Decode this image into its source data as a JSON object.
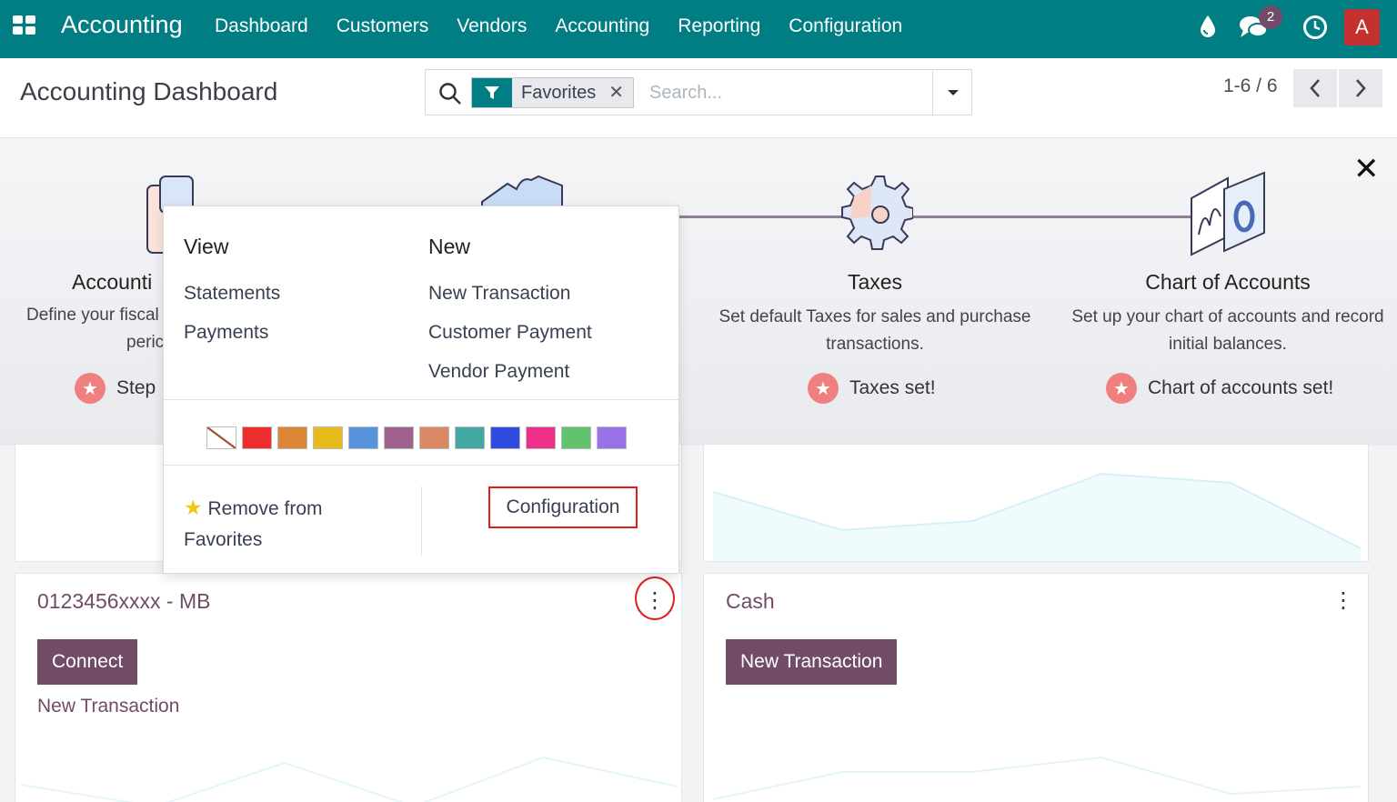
{
  "topnav": {
    "app_name": "Accounting",
    "menu": [
      "Dashboard",
      "Customers",
      "Vendors",
      "Accounting",
      "Reporting",
      "Configuration"
    ],
    "messages_count": "2",
    "avatar_letter": "A",
    "bar_color": "#017e84",
    "icons": [
      "apps-grid-icon",
      "drop-icon",
      "chat-icon",
      "clock-icon"
    ]
  },
  "control_panel": {
    "title": "Accounting Dashboard",
    "facet": "Favorites",
    "search_placeholder": "Search...",
    "pager": "1-6 / 6"
  },
  "onboarding": {
    "steps": [
      {
        "title": "Accounti",
        "desc_line1": "Define your fiscal",
        "desc_line2": "peric",
        "status": "Step"
      },
      {
        "title": "Taxes",
        "desc_line1": "Set default Taxes for sales and purchase",
        "desc_line2": "transactions.",
        "status": "Taxes set!"
      },
      {
        "title": "Chart of Accounts",
        "desc_line1": "Set up your chart of accounts and record",
        "desc_line2": "initial balances.",
        "status": "Chart of accounts set!"
      }
    ]
  },
  "dropdown": {
    "view_header": "View",
    "view_items": [
      "Statements",
      "Payments"
    ],
    "new_header": "New",
    "new_items": [
      "New Transaction",
      "Customer Payment",
      "Vendor Payment"
    ],
    "colors": [
      "#ffffff",
      "#ee2d2d",
      "#dc8534",
      "#e8bb1d",
      "#5794dd",
      "#9f628f",
      "#db8865",
      "#41a9a2",
      "#304be0",
      "#ee2f8a",
      "#61c36e",
      "#9872e6"
    ],
    "favorite_line1": "Remove from",
    "favorite_line2": "Favorites",
    "configuration": "Configuration"
  },
  "cards": [
    {
      "title": "0123456xxxx - MB",
      "primary_button": "Connect",
      "link": "New Transaction"
    },
    {
      "title": "Cash",
      "primary_button": "New Transaction"
    }
  ],
  "accent_color": "#714b67",
  "highlight_color": "#e31c1c"
}
